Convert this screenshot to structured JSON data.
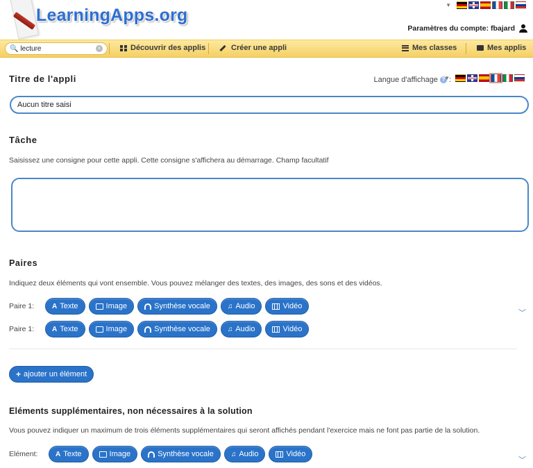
{
  "header": {
    "logo_text": "LearningApps.org",
    "account_label": "Paramètres du compte: fbajard",
    "flags": [
      "de",
      "gb",
      "es",
      "fr",
      "it",
      "ru"
    ]
  },
  "navbar": {
    "search_value": "lecture",
    "discover_label": "Découvrir des applis",
    "create_label": "Créer une appli",
    "classes_label": "Mes classes",
    "apps_label": "Mes applis"
  },
  "title_section": {
    "heading": "Titre de l'appli",
    "language_label": "Langue d'affichage",
    "language_colon": ":",
    "help_symbol": "?",
    "input_value": "Aucun titre saisi",
    "selected_language": "fr"
  },
  "task_section": {
    "heading": "Tâche",
    "help": "Saisissez une consigne pour cette appli. Cette consigne s'affichera au démarrage. Champ facultatif",
    "value": ""
  },
  "pairs_section": {
    "heading": "Paires",
    "help": "Indiquez deux éléments qui vont ensemble. Vous pouvez mélanger des textes, des images, des sons et des vidéos.",
    "rows": [
      {
        "label": "Paire 1:"
      },
      {
        "label": "Paire 1:"
      }
    ],
    "buttons": {
      "text": "Texte",
      "image": "Image",
      "speech": "Synthèse vocale",
      "audio": "Audio",
      "video": "Vidéo"
    },
    "add_label": "ajouter un élément"
  },
  "extra_section": {
    "heading": "Eléments supplémentaires, non nécessaires à la solution",
    "help": "Vous pouvez indiquer un maximum de trois éléments supplémentaires qui seront affichés pendant l'exercice mais ne font pas partie de la solution.",
    "row_label": "Elément:"
  },
  "colors": {
    "accent_blue": "#2a73c9",
    "navbar_yellow": "#f5d064",
    "logo_blue": "#2e6fd0"
  }
}
